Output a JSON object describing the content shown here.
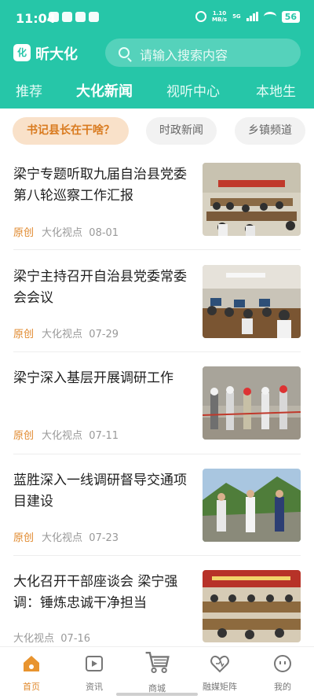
{
  "status_bar": {
    "time": "11:04",
    "speed_value": "1.10",
    "speed_unit": "MB/s",
    "network": "5G",
    "battery": "56"
  },
  "app": {
    "logo_icon": "化",
    "name": "昕大化"
  },
  "search": {
    "placeholder": "请输入搜索内容",
    "icon": "search-icon"
  },
  "tabs": [
    {
      "label": "推荐",
      "active": false
    },
    {
      "label": "大化新闻",
      "active": true
    },
    {
      "label": "视听中心",
      "active": false
    },
    {
      "label": "本地生",
      "active": false
    }
  ],
  "chips": [
    {
      "label": "书记县长在干啥？",
      "active": true
    },
    {
      "label": "时政新闻",
      "active": false
    },
    {
      "label": "乡镇频道",
      "active": false
    }
  ],
  "news": [
    {
      "title": "梁宁专题听取九届自治县党委第八轮巡察工作汇报",
      "original": "原创",
      "source": "大化视点",
      "date": "08-01"
    },
    {
      "title": "梁宁主持召开自治县党委常委会会议",
      "original": "原创",
      "source": "大化视点",
      "date": "07-29"
    },
    {
      "title": "梁宁深入基层开展调研工作",
      "original": "原创",
      "source": "大化视点",
      "date": "07-11"
    },
    {
      "title": "蓝胜深入一线调研督导交通项目建设",
      "original": "原创",
      "source": "大化视点",
      "date": "07-23"
    },
    {
      "title": "大化召开干部座谈会 梁宁强调：锤炼忠诚干净担当",
      "original": "",
      "source": "大化视点",
      "date": "07-16"
    }
  ],
  "bottom_nav": [
    {
      "label": "首页",
      "icon": "home-icon",
      "active": true
    },
    {
      "label": "资讯",
      "icon": "play-icon",
      "active": false
    },
    {
      "label": "商城",
      "icon": "cart-icon",
      "active": false
    },
    {
      "label": "融媒矩阵",
      "icon": "heart-icon",
      "active": false
    },
    {
      "label": "我的",
      "icon": "smile-icon",
      "active": false
    }
  ],
  "colors": {
    "brand": "#26C6A8",
    "accent": "#E0892D",
    "chip_active_bg": "#F9E1C9"
  }
}
